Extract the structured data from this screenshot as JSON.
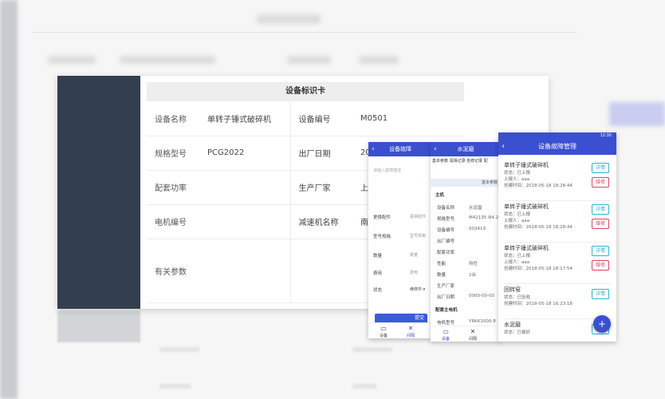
{
  "card": {
    "title": "设备标识卡",
    "rows": [
      {
        "k1": "设备名称",
        "v1": "单转子锤式破碎机",
        "k2": "设备编号",
        "v2": "M0501"
      },
      {
        "k1": "规格型号",
        "v1": "PCG2022",
        "k2": "出厂日期",
        "v2": "2012"
      },
      {
        "k1": "配套功率",
        "v1": "",
        "k2": "生产厂家",
        "v2": "上海"
      },
      {
        "k1": "电机编号",
        "v1": "",
        "k2": "减速机名称",
        "v2": "南高"
      },
      {
        "k1": "有关参数",
        "v1": "",
        "k2": "",
        "v2": ""
      }
    ]
  },
  "phone1": {
    "title": "设备故障",
    "placeholder": "请输入故障描述",
    "rows": [
      {
        "label": "更换配件",
        "value": "更换配件"
      },
      {
        "label": "型号规格",
        "value": "型号规格"
      },
      {
        "label": "数量",
        "value": "数量"
      },
      {
        "label": "费用",
        "value": "费用"
      },
      {
        "label": "状态",
        "value": "维修中 ▾"
      }
    ],
    "submit": "提交",
    "tabs": [
      "设备",
      "间隔"
    ]
  },
  "phone2": {
    "title": "水泥磨",
    "tabs": "基本参数 润滑记录 检修记录 配",
    "section": "基本参数",
    "group1": "主机",
    "fields1": [
      {
        "k": "设备名称",
        "v": "水泥磨"
      },
      {
        "k": "规格型号",
        "v": "M42135 Φ4.2"
      },
      {
        "k": "设备编号",
        "v": "002419"
      },
      {
        "k": "出厂编号",
        "v": ""
      },
      {
        "k": "配套功率",
        "v": ""
      },
      {
        "k": "性能",
        "v": "特性"
      },
      {
        "k": "数量",
        "v": "2台"
      },
      {
        "k": "生产厂家",
        "v": ""
      },
      {
        "k": "出厂日期",
        "v": "0000-00-00"
      }
    ],
    "group2": "配套主电机",
    "fields2": [
      {
        "k": "电机型号",
        "v": "YRKK1000-8"
      }
    ],
    "bottom_tabs": [
      "设备",
      "间隔"
    ]
  },
  "phone3": {
    "status_time": "12:30",
    "title": "设备故障管理",
    "items": [
      {
        "name": "单转子锤式破碎机",
        "status": "状态：已上报",
        "reporter": "上报人：aaa",
        "time": "创建时间：2018-05-18 18:28:44",
        "buttons": [
          "详情",
          "维修"
        ]
      },
      {
        "name": "单转子锤式破碎机",
        "status": "状态：已上报",
        "reporter": "上报人：aaa",
        "time": "创建时间：2018-05-18 18:28:44",
        "buttons": [
          "详情",
          "维修"
        ]
      },
      {
        "name": "单转子锤式破碎机",
        "status": "状态：已上报",
        "reporter": "上报人：aaa",
        "time": "创建时间：2018-05-18 18:17:54",
        "buttons": [
          "详情",
          "维修"
        ]
      },
      {
        "name": "回转窑",
        "status": "状态：已验收",
        "reporter": "",
        "time": "创建时间：2018-05-18 16:23:18",
        "buttons": [
          "详情"
        ]
      },
      {
        "name": "水泥磨",
        "status": "状态：已维好",
        "reporter": "",
        "time": "",
        "buttons": [
          "详情"
        ]
      }
    ],
    "fab": "+"
  },
  "colors": {
    "sidebar": "#333f4f",
    "primary": "#3b4fd1",
    "detail": "#2ab4d6",
    "repair": "#e0455e"
  }
}
